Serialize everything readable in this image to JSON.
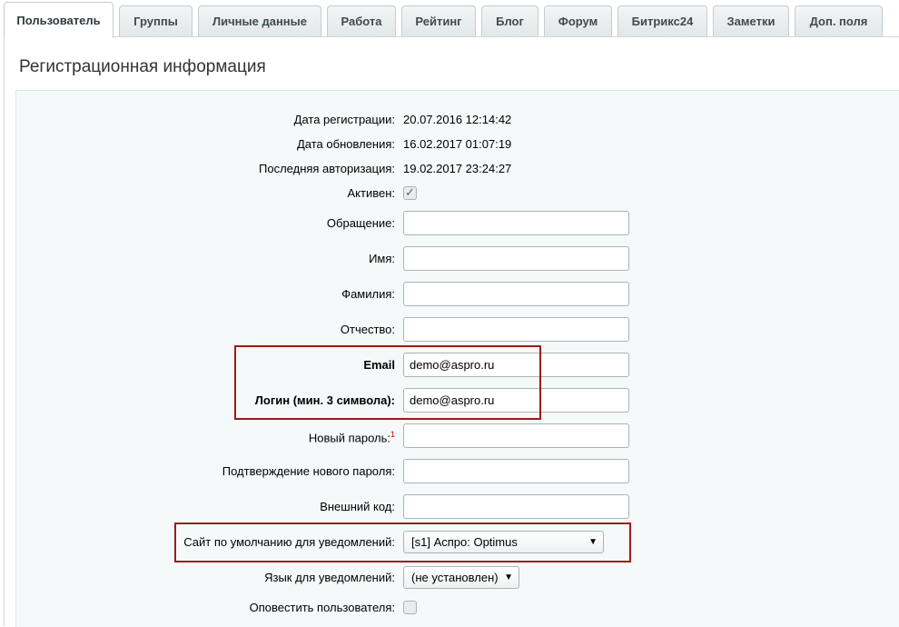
{
  "tabs": [
    {
      "label": "Пользователь",
      "active": true
    },
    {
      "label": "Группы"
    },
    {
      "label": "Личные данные"
    },
    {
      "label": "Работа"
    },
    {
      "label": "Рейтинг"
    },
    {
      "label": "Блог"
    },
    {
      "label": "Форум"
    },
    {
      "label": "Битрикс24"
    },
    {
      "label": "Заметки"
    },
    {
      "label": "Доп. поля"
    }
  ],
  "panel": {
    "title": "Регистрационная информация"
  },
  "form": {
    "reg_date_label": "Дата регистрации:",
    "reg_date_value": "20.07.2016 12:14:42",
    "update_date_label": "Дата обновления:",
    "update_date_value": "16.02.2017 01:07:19",
    "last_auth_label": "Последняя авторизация:",
    "last_auth_value": "19.02.2017 23:24:27",
    "active_label": "Активен:",
    "active_checked": true,
    "title_label": "Обращение:",
    "title_value": "",
    "name_label": "Имя:",
    "name_value": "",
    "last_name_label": "Фамилия:",
    "last_name_value": "",
    "second_name_label": "Отчество:",
    "second_name_value": "",
    "email_label": "Email",
    "email_value": "demo@aspro.ru",
    "login_label": "Логин (мин. 3 символа):",
    "login_value": "demo@aspro.ru",
    "new_password_label": "Новый пароль:",
    "new_password_note": "1",
    "confirm_password_label": "Подтверждение нового пароля:",
    "external_code_label": "Внешний код:",
    "default_site_label": "Сайт по умолчанию для уведомлений:",
    "default_site_value": "[s1] Аспро: Optimus",
    "language_label": "Язык для уведомлений:",
    "language_value": "(не установлен)",
    "notify_label": "Оповестить пользователя:",
    "notify_checked": false
  },
  "icons": {
    "dropdown": "triangle-down-icon",
    "check": "checkmark-icon"
  },
  "colors": {
    "highlight": "#9b1b1b",
    "panel_bg": "#f5f9f9"
  }
}
